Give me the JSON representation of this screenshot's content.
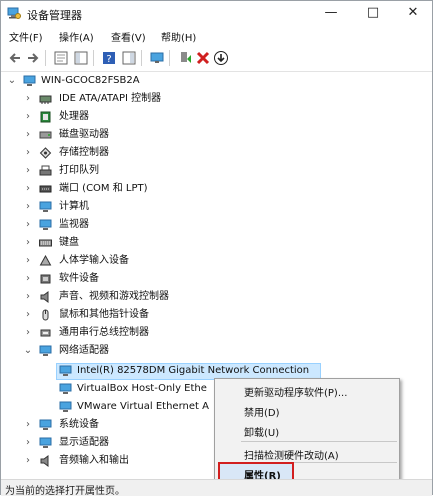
{
  "window": {
    "title": "设备管理器",
    "controls": {
      "minimize": "—",
      "maximize": "□",
      "close": "✕"
    }
  },
  "menubar": {
    "items": [
      {
        "label": "文件(F)"
      },
      {
        "label": "操作(A)"
      },
      {
        "label": "查看(V)"
      },
      {
        "label": "帮助(H)"
      }
    ]
  },
  "toolbar": {
    "icons": [
      "back-arrow-icon",
      "forward-arrow-icon",
      "properties-sheet-icon",
      "show-hide-tree-icon",
      "help-icon",
      "action-pane-icon",
      "scan-monitor-icon",
      "update-driver-icon",
      "uninstall-x-icon",
      "disable-down-arrow-icon"
    ]
  },
  "tree": {
    "root": "WIN-GCOC82FSB2A",
    "categories": [
      {
        "label": "IDE ATA/ATAPI 控制器",
        "icon": "ide-controller-icon"
      },
      {
        "label": "处理器",
        "icon": "processor-icon"
      },
      {
        "label": "磁盘驱动器",
        "icon": "disk-drive-icon"
      },
      {
        "label": "存储控制器",
        "icon": "storage-controller-icon"
      },
      {
        "label": "打印队列",
        "icon": "printer-icon"
      },
      {
        "label": "端口 (COM 和 LPT)",
        "icon": "port-icon"
      },
      {
        "label": "计算机",
        "icon": "computer-icon"
      },
      {
        "label": "监视器",
        "icon": "monitor-icon"
      },
      {
        "label": "键盘",
        "icon": "keyboard-icon"
      },
      {
        "label": "人体学输入设备",
        "icon": "hid-icon"
      },
      {
        "label": "软件设备",
        "icon": "software-device-icon"
      },
      {
        "label": "声音、视频和游戏控制器",
        "icon": "sound-icon"
      },
      {
        "label": "鼠标和其他指针设备",
        "icon": "mouse-icon"
      },
      {
        "label": "通用串行总线控制器",
        "icon": "usb-icon"
      },
      {
        "label": "网络适配器",
        "icon": "network-adapter-icon"
      }
    ],
    "network_children": [
      {
        "label": "Intel(R) 82578DM Gigabit Network Connection"
      },
      {
        "label": "VirtualBox Host-Only Ethe"
      },
      {
        "label": "VMware Virtual Ethernet A"
      }
    ],
    "after": [
      {
        "label": "系统设备",
        "icon": "system-device-icon"
      },
      {
        "label": "显示适配器",
        "icon": "display-adapter-icon"
      },
      {
        "label": "音频输入和输出",
        "icon": "audio-io-icon"
      }
    ]
  },
  "context_menu": {
    "items": [
      {
        "label": "更新驱动程序软件(P)..."
      },
      {
        "label": "禁用(D)"
      },
      {
        "label": "卸载(U)"
      },
      {
        "label": "扫描检测硬件改动(A)"
      },
      {
        "label": "属性(R)"
      }
    ]
  },
  "statusbar": {
    "text": "为当前的选择打开属性页。"
  },
  "colors": {
    "selection": "#cce8ff",
    "highlight_box": "#d21f1f",
    "accent": "#0078d7"
  }
}
